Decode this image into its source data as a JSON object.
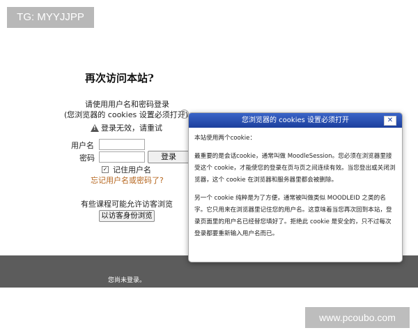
{
  "overlay_tag": "TG: MYYJJPP",
  "login": {
    "title": "再次访问本站?",
    "hint_line1": "请使用用户名和密码登录",
    "hint_line2": "(您浏览器的 cookies 设置必须打开)",
    "help_icon": "?",
    "error": "登录无效，请重试",
    "username_label": "用户名",
    "password_label": "密码",
    "username_value": "",
    "password_value": "",
    "login_button": "登录",
    "remember_checked": true,
    "remember_label": "记住用户名",
    "forgot_link": "忘记用户名或密码了?",
    "guest_hint": "有些课程可能允许访客浏览",
    "guest_button": "以访客身份浏览"
  },
  "footer": {
    "text": "您尚未登录。"
  },
  "watermark": "www.pcoubo.com",
  "dialog": {
    "title": "您浏览器的 cookies 设置必须打开",
    "close": "✕",
    "para1": "本站使用两个cookie：",
    "para2": "最重要的是会话cookie，通常叫做 MoodleSession。您必须在浏览器里接受这个 cookie，才能使您的登录在页与页之间连续有效。当您登出或关闭浏览器，这个 cookie 在浏览器和服务器里都会被删除。",
    "para3": "另一个 cookie 纯粹是为了方便，通常被叫做类似 MOODLEID 之类的名字。它只用来在浏览器里记住您的用户名。这意味着当您再次回到本站，登录页面里的用户名已经替您填好了。拒绝此 cookie 是安全的，只不过每次登录都要重新输入用户名而已。"
  }
}
